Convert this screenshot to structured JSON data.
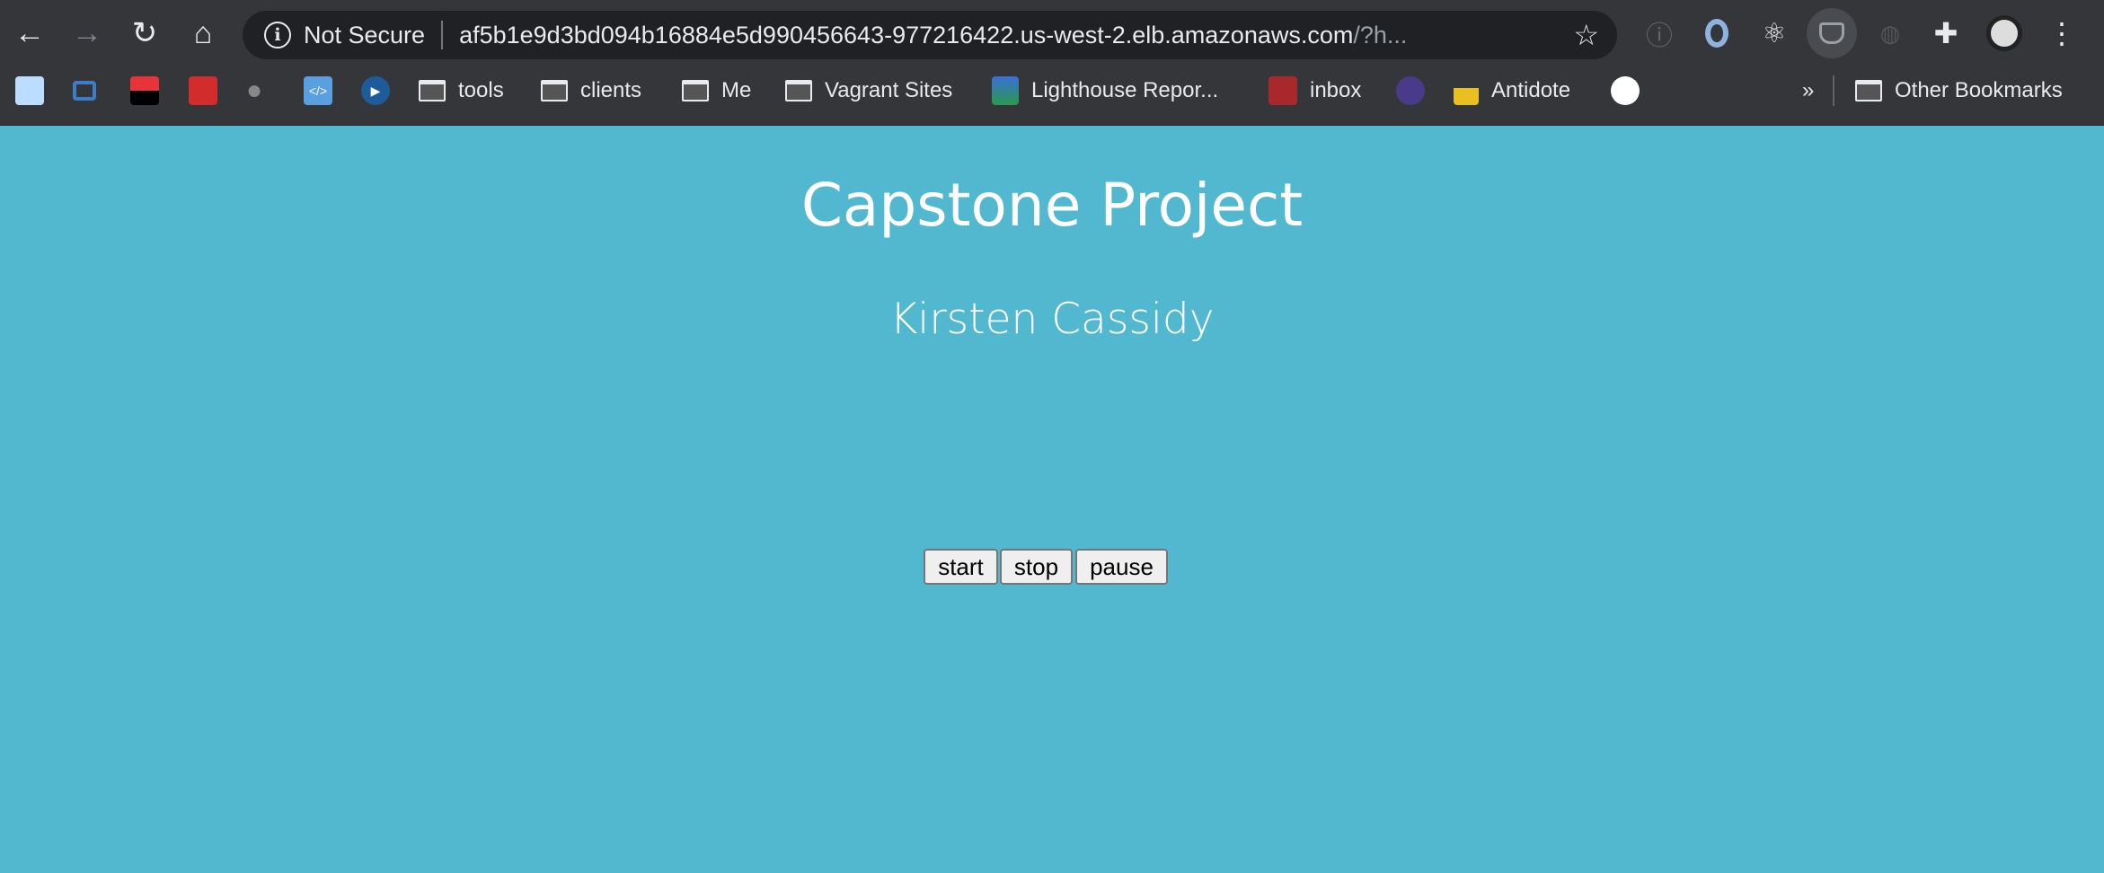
{
  "browser": {
    "address": {
      "security_label": "Not Secure",
      "url_main": "af5b1e9d3bd094b16884e5d990456643-977216422.us-west-2.elb.amazonaws.com",
      "url_rest": "/?h..."
    },
    "bookmarks": [
      {
        "label": "tools"
      },
      {
        "label": "clients"
      },
      {
        "label": "Me"
      },
      {
        "label": "Vagrant Sites"
      },
      {
        "label": "Lighthouse Repor..."
      },
      {
        "label": "inbox"
      },
      {
        "label": "Antidote"
      }
    ],
    "overflow_label": "»",
    "other_bookmarks": "Other Bookmarks"
  },
  "page": {
    "title": "Capstone Project",
    "subtitle": "Kirsten Cassidy",
    "buttons": {
      "start": "start",
      "stop": "stop",
      "pause": "pause"
    },
    "background": "#52b8d0"
  }
}
